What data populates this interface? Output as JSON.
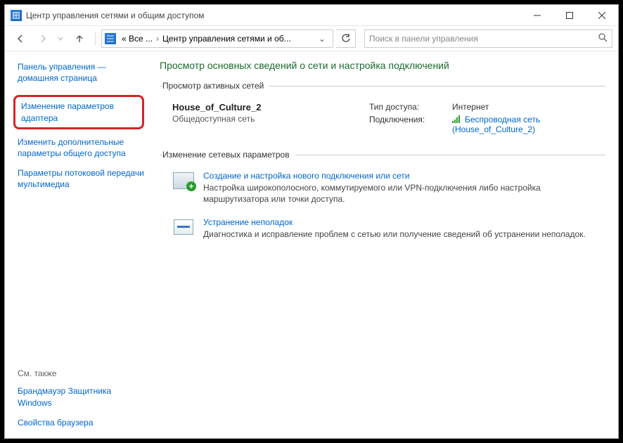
{
  "window": {
    "title": "Центр управления сетями и общим доступом"
  },
  "breadcrumb": {
    "root": "« Все ...",
    "current": "Центр управления сетями и об..."
  },
  "search": {
    "placeholder": "Поиск в панели управления"
  },
  "sidebar": {
    "home": "Панель управления — домашняя страница",
    "adapter": "Изменение параметров адаптера",
    "sharing": "Изменить дополнительные параметры общего доступа",
    "streaming": "Параметры потоковой передачи мультимедиа",
    "see_also_header": "См. также",
    "firewall": "Брандмауэр Защитника Windows",
    "browser": "Свойства браузера"
  },
  "content": {
    "page_title": "Просмотр основных сведений о сети и настройка подключений",
    "active_networks_legend": "Просмотр активных сетей",
    "network": {
      "name": "House_of_Culture_2",
      "type": "Общедоступная сеть",
      "access_label": "Тип доступа:",
      "access_value": "Интернет",
      "conn_label": "Подключения:",
      "conn_value": "Беспроводная сеть (House_of_Culture_2)"
    },
    "change_settings_legend": "Изменение сетевых параметров",
    "new_conn": {
      "title": "Создание и настройка нового подключения или сети",
      "desc": "Настройка широкополосного, коммутируемого или VPN-подключения либо настройка маршрутизатора или точки доступа."
    },
    "troubleshoot": {
      "title": "Устранение неполадок",
      "desc": "Диагностика и исправление проблем с сетью или получение сведений об устранении неполадок."
    }
  }
}
